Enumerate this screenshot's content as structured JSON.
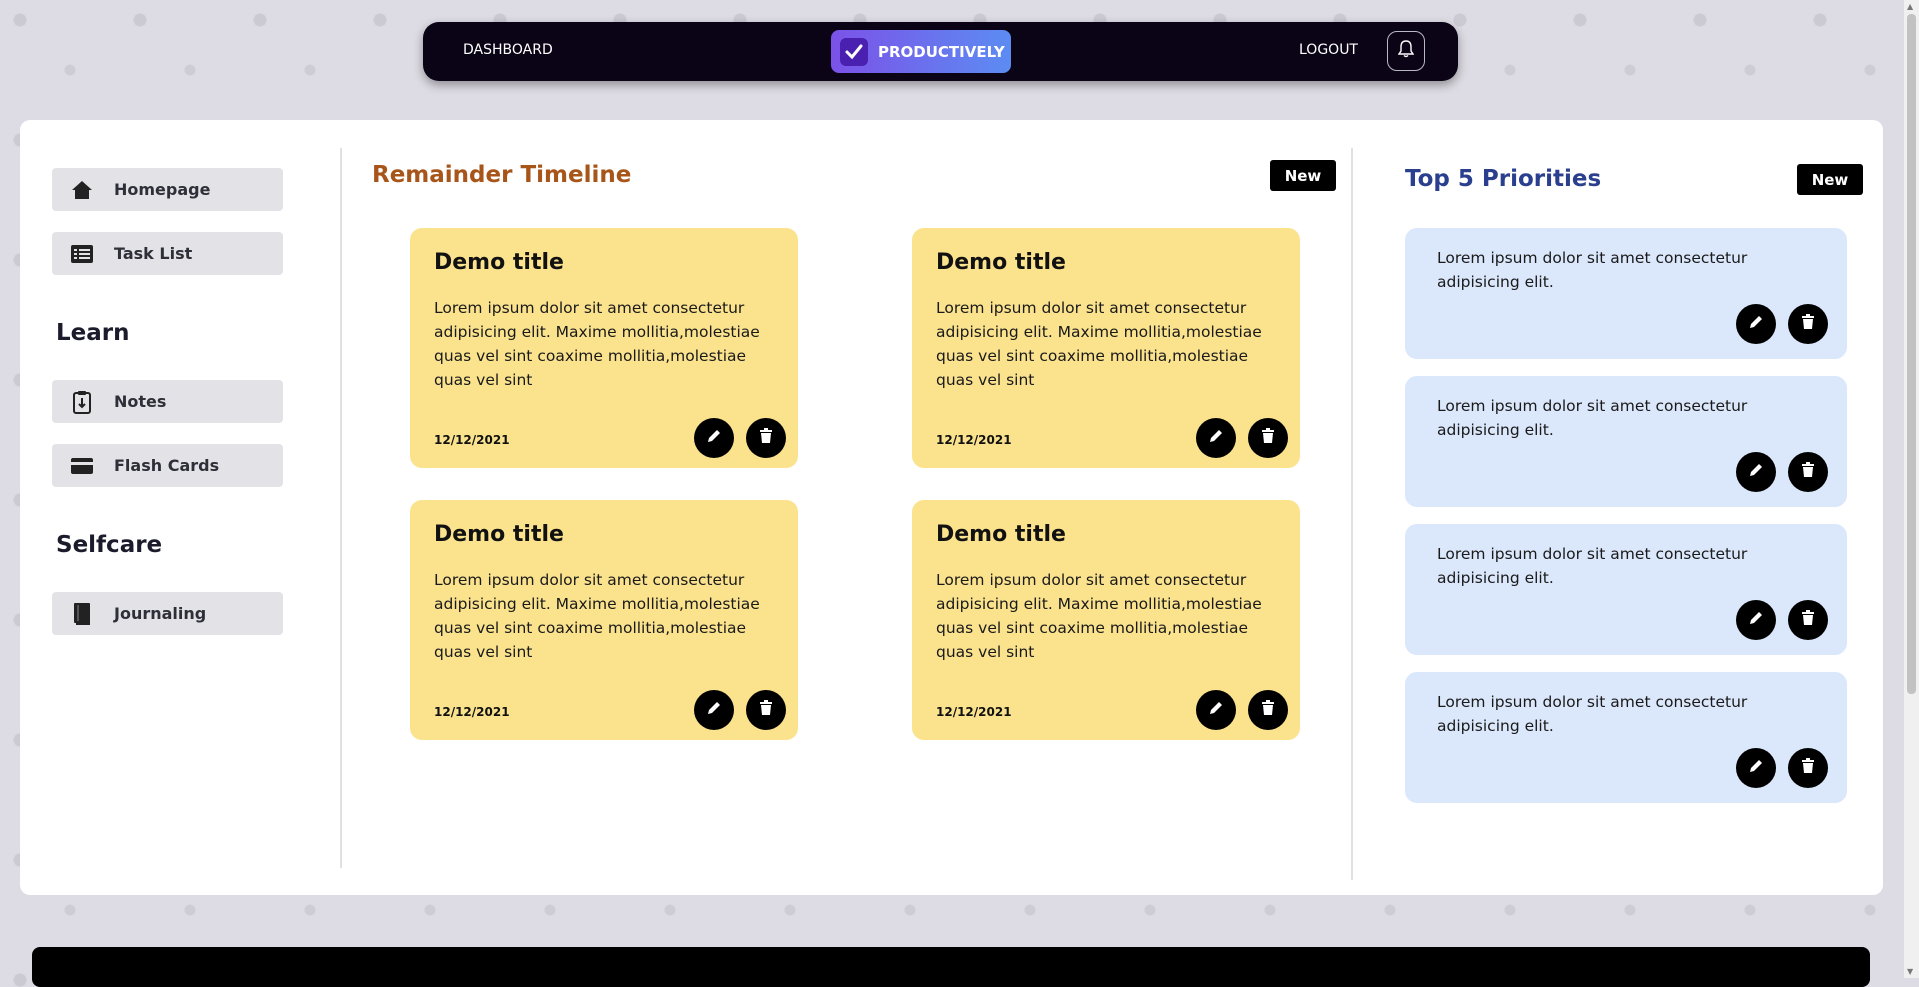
{
  "navbar": {
    "dashboard_label": "DASHBOARD",
    "brand_label": "PRODUCTIVELY",
    "logout_label": "LOGOUT"
  },
  "sidebar": {
    "top_items": [
      {
        "label": "Homepage",
        "icon": "home-icon"
      },
      {
        "label": "Task List",
        "icon": "list-icon"
      }
    ],
    "learn_heading": "Learn",
    "learn_items": [
      {
        "label": "Notes",
        "icon": "clipboard-icon"
      },
      {
        "label": "Flash Cards",
        "icon": "card-icon"
      }
    ],
    "selfcare_heading": "Selfcare",
    "selfcare_items": [
      {
        "label": "Journaling",
        "icon": "book-icon"
      }
    ]
  },
  "timeline": {
    "title": "Remainder Timeline",
    "new_label": "New",
    "notes": [
      {
        "title": "Demo title",
        "body": "Lorem ipsum dolor sit amet consectetur adipisicing elit. Maxime mollitia,molestiae quas vel sint coaxime mollitia,molestiae quas vel sint",
        "date": "12/12/2021"
      },
      {
        "title": "Demo title",
        "body": "Lorem ipsum dolor sit amet consectetur adipisicing elit. Maxime mollitia,molestiae quas vel sint coaxime mollitia,molestiae quas vel sint",
        "date": "12/12/2021"
      },
      {
        "title": "Demo title",
        "body": "Lorem ipsum dolor sit amet consectetur adipisicing elit. Maxime mollitia,molestiae quas vel sint coaxime mollitia,molestiae quas vel sint",
        "date": "12/12/2021"
      },
      {
        "title": "Demo title",
        "body": "Lorem ipsum dolor sit amet consectetur adipisicing elit. Maxime mollitia,molestiae quas vel sint coaxime mollitia,molestiae quas vel sint",
        "date": "12/12/2021"
      }
    ]
  },
  "priorities": {
    "title": "Top 5 Priorities",
    "new_label": "New",
    "items": [
      {
        "text": "Lorem ipsum dolor sit amet consectetur adipisicing elit."
      },
      {
        "text": "Lorem ipsum dolor sit amet consectetur adipisicing elit."
      },
      {
        "text": "Lorem ipsum dolor sit amet consectetur adipisicing elit."
      },
      {
        "text": "Lorem ipsum dolor sit amet consectetur adipisicing elit."
      }
    ]
  },
  "colors": {
    "note_bg": "#fbe38e",
    "priority_bg": "#dbe7fb",
    "timeline_title": "#a8551a",
    "priority_title": "#2b3f8f",
    "navbar_bg": "#0b0416"
  }
}
